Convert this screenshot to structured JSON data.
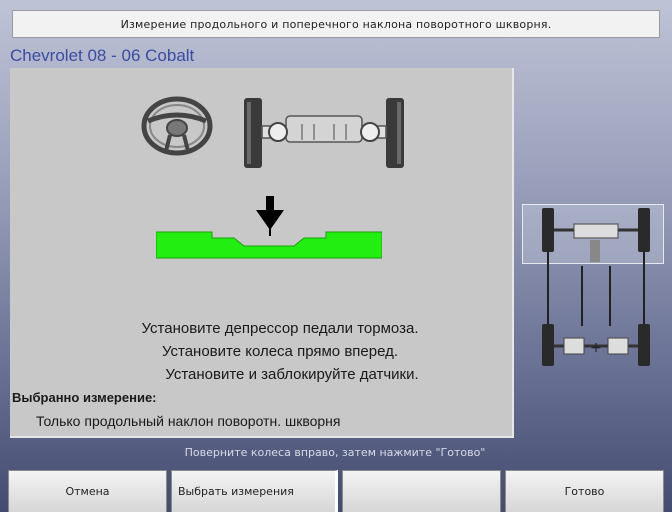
{
  "header": {
    "title": "Измерение продольного и поперечного наклона поворотного шкворня."
  },
  "vehicle": {
    "name": "Chevrolet 08 - 06 Cobalt"
  },
  "instructions": {
    "line1": "Установите депрессор педали тормоза.",
    "line2": "Установите колеса прямо вперед.",
    "line3": "Установите и заблокируйте датчики."
  },
  "selected": {
    "heading": "Выбранно измерение:",
    "value": "Только продольный наклон поворотн. шкворня"
  },
  "status": {
    "text": "Поверните колеса вправо, затем нажмите \"Готово\""
  },
  "buttons": {
    "cancel": "Отмена",
    "select": "Выбрать измерения",
    "empty": "",
    "done": "Готово"
  },
  "colors": {
    "pad_green": "#22ee11",
    "vehicle_text": "#3a4da0"
  },
  "icons": {
    "steering": "steering-wheel-icon",
    "axle": "axle-icon",
    "arrow": "down-arrow-icon"
  }
}
